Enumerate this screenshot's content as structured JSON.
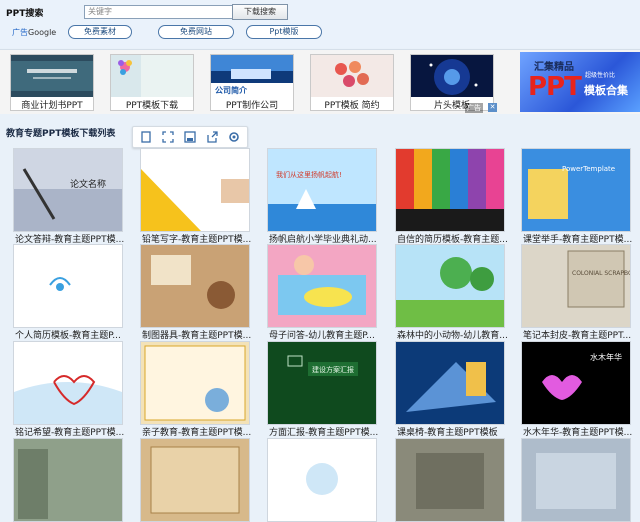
{
  "search": {
    "label": "PPT搜索",
    "placeholder": "关键字",
    "button": "下载搜索"
  },
  "google_ads": {
    "prefix": "广告",
    "brand": "Google"
  },
  "pills": [
    "免费素材",
    "免费网站",
    "Ppt模版"
  ],
  "ads": [
    {
      "caption": "商业计划书PPT"
    },
    {
      "caption": "PPT模板下载"
    },
    {
      "caption": "PPT制作公司",
      "overlay": "公司简介"
    },
    {
      "caption": "PPT模板 简约"
    },
    {
      "caption": "片头模板"
    }
  ],
  "ad_banner": {
    "title": "汇集精品",
    "big": "PPT",
    "sub": "超级性价比",
    "set": "模板合集"
  },
  "ad_tag": "广告",
  "ad_close": "✕",
  "section_title": "教育专题PPT模板下载列表",
  "toolbar_icons": [
    "bookmark-icon",
    "expand-icon",
    "save-icon",
    "share-icon",
    "settings-icon"
  ],
  "tiles": [
    {
      "caption": "论文答辩-教育主题PPT模...",
      "thumb_text": "论文名称"
    },
    {
      "caption": "铅笔写字-教育主题PPT模..."
    },
    {
      "caption": "扬帆启航小学毕业典礼动...",
      "thumb_text": "我们从这里扬帆起航!"
    },
    {
      "caption": "自信的简历模板-教育主题..."
    },
    {
      "caption": "课堂举手-教育主题PPT模...",
      "thumb_text": "PowerTemplate"
    },
    {
      "caption": "个人简历模板-教育主题P..."
    },
    {
      "caption": "制图器具-教育主题PPT模..."
    },
    {
      "caption": "母子问答-幼儿教育主题P..."
    },
    {
      "caption": "森林中的小动物-幼儿教育..."
    },
    {
      "caption": "笔记本封皮-教育主题PPT...",
      "thumb_text": "COLONIAL SCRAPBOOK"
    },
    {
      "caption": "铭记希望-教育主题PPT模..."
    },
    {
      "caption": "亲子教育-教育主题PPT模..."
    },
    {
      "caption": "方面汇报-教育主题PPT模...",
      "thumb_text": "建设方案汇报"
    },
    {
      "caption": "课桌椅-教育主题PPT模板"
    },
    {
      "caption": "水木年华-教育主题PPT模...",
      "thumb_text": "水木年华"
    },
    {
      "caption": ""
    },
    {
      "caption": ""
    },
    {
      "caption": ""
    },
    {
      "caption": ""
    },
    {
      "caption": ""
    }
  ],
  "colors": {
    "accent": "#2468c8",
    "brand_red": "#e8241c",
    "page_bg": "#e9f1f9"
  }
}
